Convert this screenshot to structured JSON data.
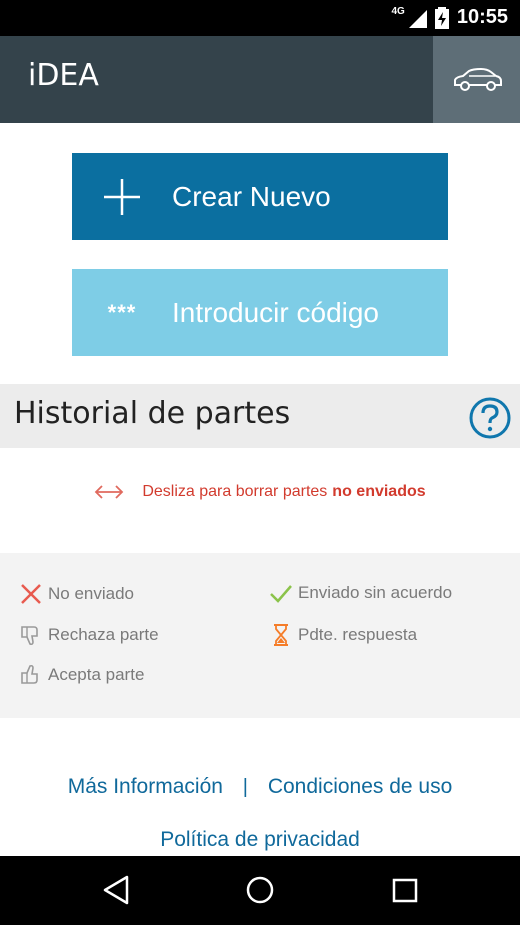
{
  "status": {
    "network": "4G",
    "time": "10:55"
  },
  "appbar": {
    "title": "iDEA",
    "car_icon": "car-icon"
  },
  "buttons": {
    "create": "Crear Nuevo",
    "code_icon": "***",
    "code": "Introducir código"
  },
  "history": {
    "title": "Historial de partes"
  },
  "swipe": {
    "text": "Desliza para borrar partes",
    "bold": "no enviados"
  },
  "legend": {
    "not_sent": "No enviado",
    "sent_no_agreement": "Enviado sin acuerdo",
    "rejects": "Rechaza parte",
    "pending": "Pdte. respuesta",
    "accepts": "Acepta parte"
  },
  "links": {
    "more_info": "Más Información",
    "separator": "|",
    "terms": "Condiciones de uso",
    "privacy": "Política de privacidad"
  },
  "colors": {
    "appbar": "#34434b",
    "create": "#0b6fa0",
    "code": "#7ecde6",
    "link": "#10699b",
    "red": "#d23b2e",
    "green": "#8bc34a",
    "orange": "#f57c28"
  }
}
